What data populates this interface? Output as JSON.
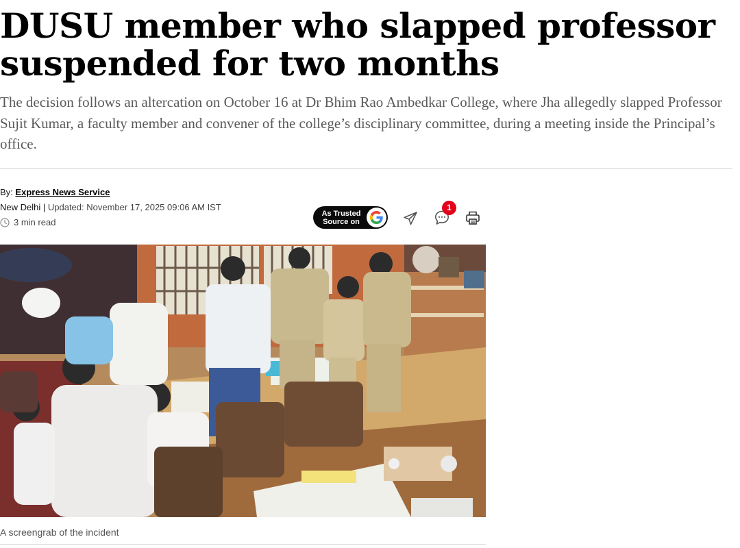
{
  "article": {
    "headline": "DUSU member who slapped professor suspended for two months",
    "synopsis": "The decision follows an altercation on October 16 at Dr Bhim Rao Ambedkar College, where Jha allegedly slapped Professor Sujit Kumar, a faculty member and convener of the college’s disciplinary committee, during a meeting inside the Principal’s office.",
    "byline_prefix": "By:",
    "author": "Express News Service",
    "location": "New Delhi",
    "separator": " | ",
    "updated": "Updated: November 17, 2025 09:06 AM IST",
    "read_time": "3 min read",
    "image_caption": "A screengrab of the incident"
  },
  "actions": {
    "trusted_source_line1": "As Trusted",
    "trusted_source_line2": "Source on",
    "google_icon": "google-g-icon",
    "share_icon": "send-icon",
    "comment_icon": "comment-icon",
    "comment_count": "1",
    "print_icon": "printer-icon"
  },
  "colors": {
    "badge_red": "#e3001b",
    "synopsis_gray": "#5a5a5a",
    "trusted_button_bg": "#0b0b0b"
  }
}
